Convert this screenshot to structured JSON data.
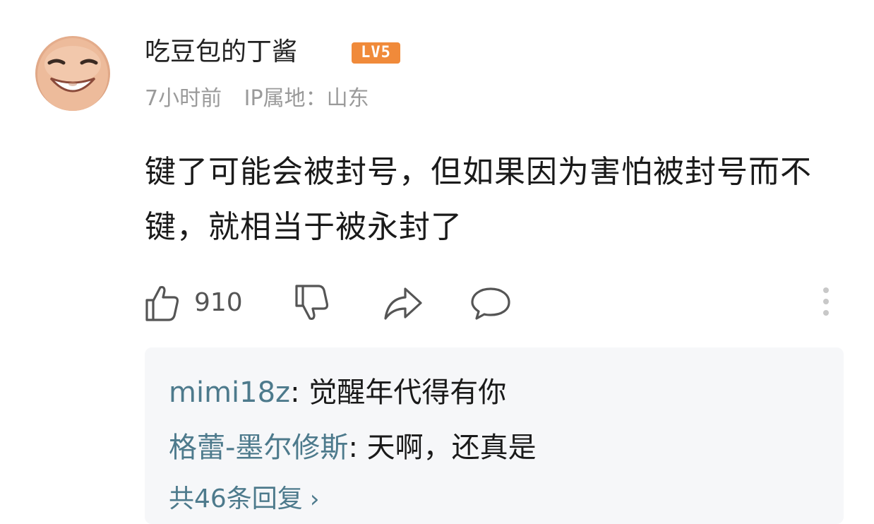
{
  "comment": {
    "username": "吃豆包的丁酱",
    "level_badge": "LV5",
    "time": "7小时前",
    "ip_location": "IP属地：山东",
    "body": "键了可能会被封号，但如果因为害怕被封号而不键，就相当于被永封了",
    "like_count": "910"
  },
  "icons": {
    "like": "thumbs-up-icon",
    "dislike": "thumbs-down-icon",
    "share": "share-icon",
    "reply": "comment-bubble-icon",
    "more": "more-vertical-icon"
  },
  "replies": {
    "items": [
      {
        "author": "mimi18z",
        "text": "觉醒年代得有你"
      },
      {
        "author": "格蕾-墨尔修斯",
        "text": "天啊，还真是"
      }
    ],
    "more_label": "共46条回复",
    "more_chevron": "›"
  },
  "colors": {
    "level_badge": "#f08a3a",
    "reply_author": "#4d7a8c",
    "meta_text": "#9a9a9a",
    "reply_background": "#f6f7f9"
  }
}
